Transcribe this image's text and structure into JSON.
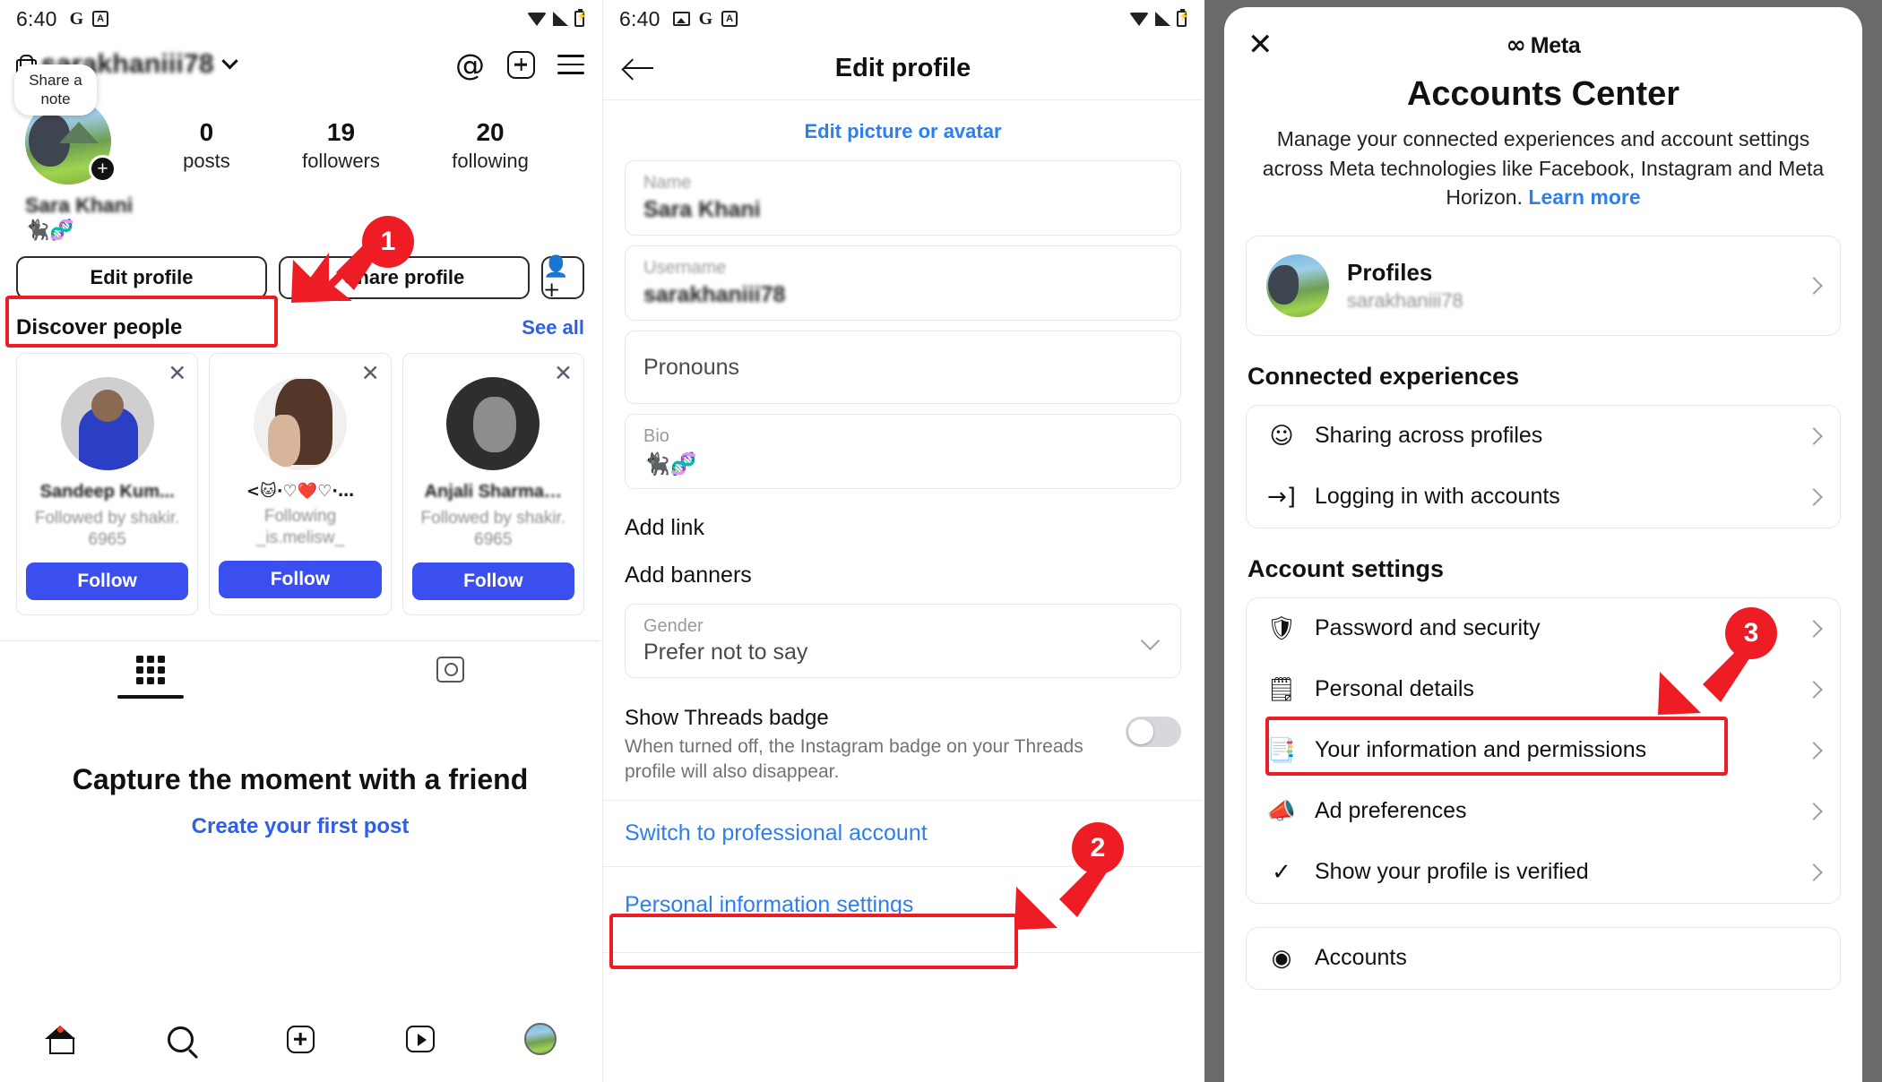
{
  "status_bars": {
    "left": {
      "time": "6:40",
      "icons": [
        "google-icon",
        "app-icon"
      ]
    },
    "mid": {
      "time": "6:40",
      "icons": [
        "image-icon",
        "google-icon",
        "app-icon"
      ]
    },
    "right_icons": [
      "wifi-icon",
      "signal-icon",
      "battery-icon"
    ]
  },
  "left_panel": {
    "username": "sarakhaniii78",
    "note_bubble": "Share a note",
    "display_name": "Sara Khani",
    "bio_emoji": "🐈‍⬛🧬",
    "stats": [
      {
        "num": "0",
        "label": "posts"
      },
      {
        "num": "19",
        "label": "followers"
      },
      {
        "num": "20",
        "label": "following"
      }
    ],
    "actions": {
      "edit_profile": "Edit profile",
      "share_profile": "Share profile",
      "add_person": "person-add-icon"
    },
    "discover": {
      "title": "Discover people",
      "see_all": "See all",
      "follow_label": "Follow",
      "cards": [
        {
          "name": "Sandeep Kum...",
          "sub": "Followed by shakir.\n6965",
          "avatar": "avatar-1"
        },
        {
          "name": "<🐱·♡❤️♡·…",
          "sub": "Following\n_is.melisw_",
          "avatar": "avatar-2"
        },
        {
          "name": "Anjali  Sharma…",
          "sub": "Followed by shakir.\n6965",
          "avatar": "avatar-3"
        }
      ]
    },
    "tabs": [
      "grid-tab",
      "tagged-tab"
    ],
    "empty_state": {
      "title": "Capture the moment with a friend",
      "link": "Create your first post"
    },
    "navbar": [
      "home-icon",
      "search-icon",
      "create-icon",
      "reels-icon",
      "profile-avatar"
    ]
  },
  "mid_panel": {
    "title": "Edit profile",
    "edit_picture_link": "Edit picture or avatar",
    "fields": [
      {
        "label": "Name",
        "value": "Sara Khani",
        "kind": "filled"
      },
      {
        "label": "Username",
        "value": "sarakhaniii78",
        "kind": "filled"
      },
      {
        "label": "Pronouns",
        "value": "",
        "kind": "placeholder"
      },
      {
        "label": "Bio",
        "value": "🐈‍⬛🧬",
        "kind": "emoji"
      }
    ],
    "add_link": "Add link",
    "add_banners": "Add banners",
    "gender": {
      "label": "Gender",
      "value": "Prefer not to say"
    },
    "threads_badge": {
      "title": "Show Threads badge",
      "desc": "When turned off, the Instagram badge on your Threads profile will also disappear.",
      "toggle_state": "off"
    },
    "switch_professional": "Switch to professional account",
    "personal_info_settings": "Personal information settings"
  },
  "right_panel": {
    "close": "close-icon",
    "brand": "Meta",
    "title": "Accounts Center",
    "description": "Manage your connected experiences and account settings across Meta technologies like Facebook, Instagram and Meta Horizon.",
    "learn_more": "Learn more",
    "profiles_row": {
      "name": "Profiles",
      "username": "sarakhaniii78"
    },
    "connected_heading": "Connected experiences",
    "connected_items": [
      {
        "label": "Sharing across profiles",
        "icon": "person-share-icon"
      },
      {
        "label": "Logging in with accounts",
        "icon": "login-arrow-icon"
      }
    ],
    "account_heading": "Account settings",
    "account_items": [
      {
        "label": "Password and security",
        "icon": "shield-icon"
      },
      {
        "label": "Personal details",
        "icon": "id-card-icon"
      },
      {
        "label": "Your information and permissions",
        "icon": "document-lock-icon"
      },
      {
        "label": "Ad preferences",
        "icon": "megaphone-icon"
      },
      {
        "label": "Show your profile is verified",
        "icon": "verified-check-icon"
      }
    ],
    "partial_item": {
      "label": "Accounts",
      "icon": "accounts-icon"
    }
  },
  "annotations": {
    "steps": [
      "1",
      "2",
      "3"
    ],
    "accent_color": "#ee1c25"
  }
}
